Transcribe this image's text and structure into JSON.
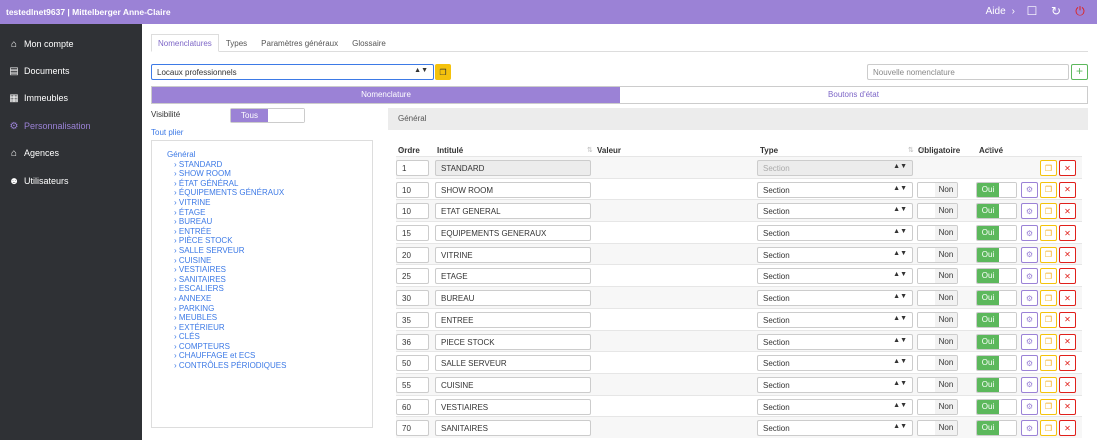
{
  "app": {
    "title": "testedlnet9637 | Mittelberger Anne-Claire",
    "help_label": "Aide",
    "icons": [
      "chevron-right-icon",
      "window-icon",
      "refresh-icon",
      "power-icon"
    ]
  },
  "sidebar": {
    "items": [
      {
        "label": "Mon compte",
        "icon": "home-icon",
        "active": false
      },
      {
        "label": "Documents",
        "icon": "document-icon",
        "active": false
      },
      {
        "label": "Immeubles",
        "icon": "building-icon",
        "active": false
      },
      {
        "label": "Personnalisation",
        "icon": "cogs-icon",
        "active": true
      },
      {
        "label": "Agences",
        "icon": "bank-icon",
        "active": false
      },
      {
        "label": "Utilisateurs",
        "icon": "users-icon",
        "active": false
      }
    ]
  },
  "tabs": [
    {
      "label": "Nomenclatures",
      "active": true
    },
    {
      "label": "Types",
      "active": false
    },
    {
      "label": "Paramètres généraux",
      "active": false
    },
    {
      "label": "Glossaire",
      "active": false
    }
  ],
  "nomenclature_select": {
    "value": "Locaux professionnels"
  },
  "new_nomenclature": {
    "placeholder": "Nouvelle nomenclature",
    "add_label": "+"
  },
  "mode_switch": {
    "active": "Nomenclature",
    "inactive": "Boutons d'état"
  },
  "visibility": {
    "label": "Visibilité",
    "value": "Tous"
  },
  "collapse_all": "Tout plier",
  "tree": {
    "root": "Général",
    "items": [
      "STANDARD",
      "SHOW ROOM",
      "ÉTAT GÉNÉRAL",
      "ÉQUIPEMENTS GÉNÉRAUX",
      "VITRINE",
      "ÉTAGE",
      "BUREAU",
      "ENTRÉE",
      "PIÈCE STOCK",
      "SALLE SERVEUR",
      "CUISINE",
      "VESTIAIRES",
      "SANITAIRES",
      "ESCALIERS",
      "ANNEXE",
      "PARKING",
      "MEUBLES",
      "EXTÉRIEUR",
      "CLÉS",
      "COMPTEURS",
      "CHAUFFAGE et ECS",
      "CONTRÔLES PÉRIODIQUES"
    ]
  },
  "section_header": "Général",
  "table": {
    "columns": {
      "ordre": "Ordre",
      "intitule": "Intitulé",
      "valeur": "Valeur",
      "type": "Type",
      "obligatoire": "Obligatoire",
      "active": "Activé"
    },
    "no_label": "Non",
    "yes_label": "Oui",
    "rows": [
      {
        "order": "1",
        "label": "STANDARD",
        "type": "Section",
        "locked": true
      },
      {
        "order": "10",
        "label": "SHOW ROOM",
        "type": "Section",
        "locked": false
      },
      {
        "order": "10",
        "label": "ETAT GENERAL",
        "type": "Section",
        "locked": false
      },
      {
        "order": "15",
        "label": "EQUIPEMENTS GENERAUX",
        "type": "Section",
        "locked": false
      },
      {
        "order": "20",
        "label": "VITRINE",
        "type": "Section",
        "locked": false
      },
      {
        "order": "25",
        "label": "ETAGE",
        "type": "Section",
        "locked": false
      },
      {
        "order": "30",
        "label": "BUREAU",
        "type": "Section",
        "locked": false
      },
      {
        "order": "35",
        "label": "ENTREE",
        "type": "Section",
        "locked": false
      },
      {
        "order": "36",
        "label": "PIECE STOCK",
        "type": "Section",
        "locked": false
      },
      {
        "order": "50",
        "label": "SALLE SERVEUR",
        "type": "Section",
        "locked": false
      },
      {
        "order": "55",
        "label": "CUISINE",
        "type": "Section",
        "locked": false
      },
      {
        "order": "60",
        "label": "VESTIAIRES",
        "type": "Section",
        "locked": false
      },
      {
        "order": "70",
        "label": "SANITAIRES",
        "type": "Section",
        "locked": false
      }
    ]
  },
  "colors": {
    "accent": "#9b82d6",
    "sidebar": "#2f3135",
    "link": "#3d7ae6",
    "success": "#5cb85c",
    "warning": "#f4c20d",
    "danger": "#e0201b"
  }
}
